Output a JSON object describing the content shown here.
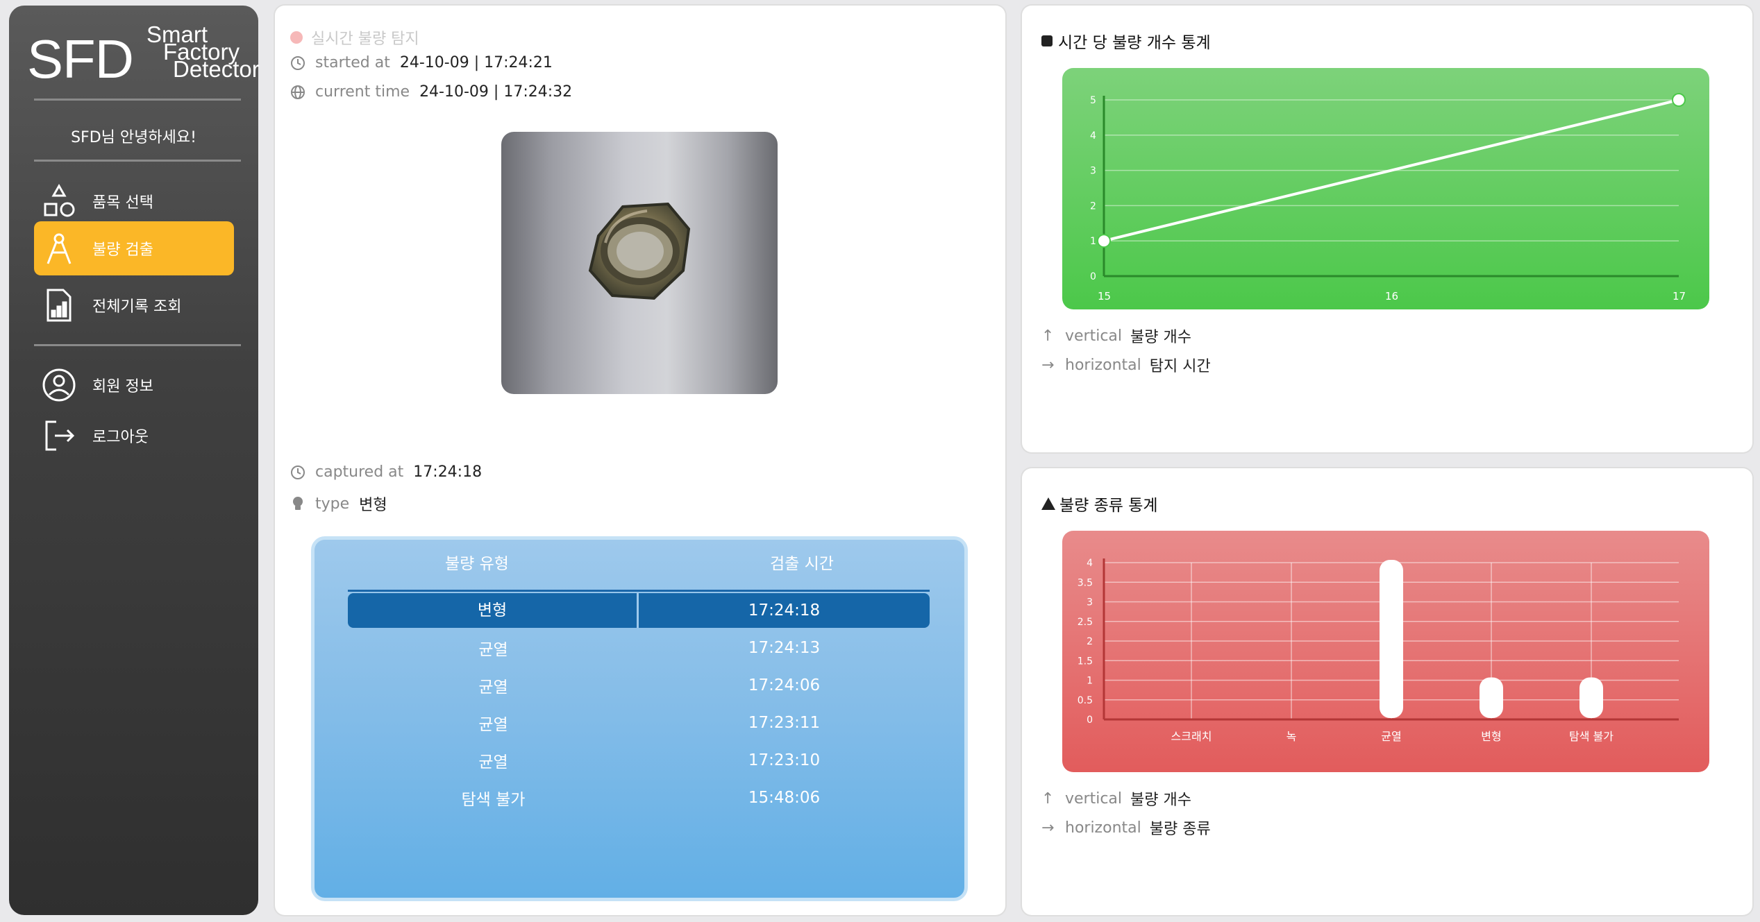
{
  "sidebar": {
    "logo_big": "SFD",
    "logo_line1": "Smart",
    "logo_line2": "Factory",
    "logo_line3": "Detector",
    "greeting": "SFD님 안녕하세요!",
    "items": [
      {
        "label": "품목 선택",
        "icon": "shapes-icon"
      },
      {
        "label": "불량 검출",
        "icon": "compass-icon",
        "active": true
      },
      {
        "label": "전체기록 조회",
        "icon": "report-icon"
      },
      {
        "label": "회원 정보",
        "icon": "user-icon"
      },
      {
        "label": "로그아웃",
        "icon": "logout-icon"
      }
    ],
    "active_color": "#fbb727"
  },
  "main": {
    "live_label": "실시간 불량 탐지",
    "started_label": "started at",
    "started_value": "24-10-09 | 17:24:21",
    "current_label": "current time",
    "current_value": "24-10-09 | 17:24:32",
    "captured_label": "captured at",
    "captured_value": "17:24:18",
    "type_label": "type",
    "type_value": "변형",
    "table": {
      "headers": [
        "불량 유형",
        "검출 시간"
      ],
      "rows": [
        {
          "type": "변형",
          "time": "17:24:18",
          "selected": true
        },
        {
          "type": "균열",
          "time": "17:24:13"
        },
        {
          "type": "균열",
          "time": "17:24:06"
        },
        {
          "type": "균열",
          "time": "17:23:11"
        },
        {
          "type": "균열",
          "time": "17:23:10"
        },
        {
          "type": "탐색 불가",
          "time": "15:48:06"
        }
      ]
    }
  },
  "top_panel": {
    "title": "시간 당 불량 개수 통계",
    "vertical_label": "vertical",
    "vertical_value": "불량 개수",
    "horizontal_label": "horizontal",
    "horizontal_value": "탐지 시간"
  },
  "bottom_panel": {
    "title": "불량 종류 통계",
    "vertical_label": "vertical",
    "vertical_value": "불량 개수",
    "horizontal_label": "horizontal",
    "horizontal_value": "불량 종류"
  },
  "chart_data": [
    {
      "type": "line",
      "x": [
        15,
        16,
        17
      ],
      "series": [
        {
          "values": [
            1,
            null,
            5
          ]
        }
      ],
      "points": [
        {
          "x": 15,
          "y": 1
        },
        {
          "x": 17,
          "y": 5
        }
      ],
      "yticks": [
        0,
        1,
        2,
        3,
        4,
        5
      ],
      "xticks": [
        15,
        16,
        17
      ],
      "ylim": [
        0,
        5
      ],
      "grid": true,
      "background": "#55c953"
    },
    {
      "type": "bar",
      "categories": [
        "스크래치",
        "녹",
        "균열",
        "변형",
        "탐색 불가"
      ],
      "values": [
        0,
        0,
        4,
        1,
        1
      ],
      "yticks": [
        0,
        0.5,
        1,
        1.5,
        2,
        2.5,
        3,
        3.5,
        4
      ],
      "ylim": [
        0,
        4
      ],
      "grid": true,
      "background": "#e46a6a"
    }
  ]
}
